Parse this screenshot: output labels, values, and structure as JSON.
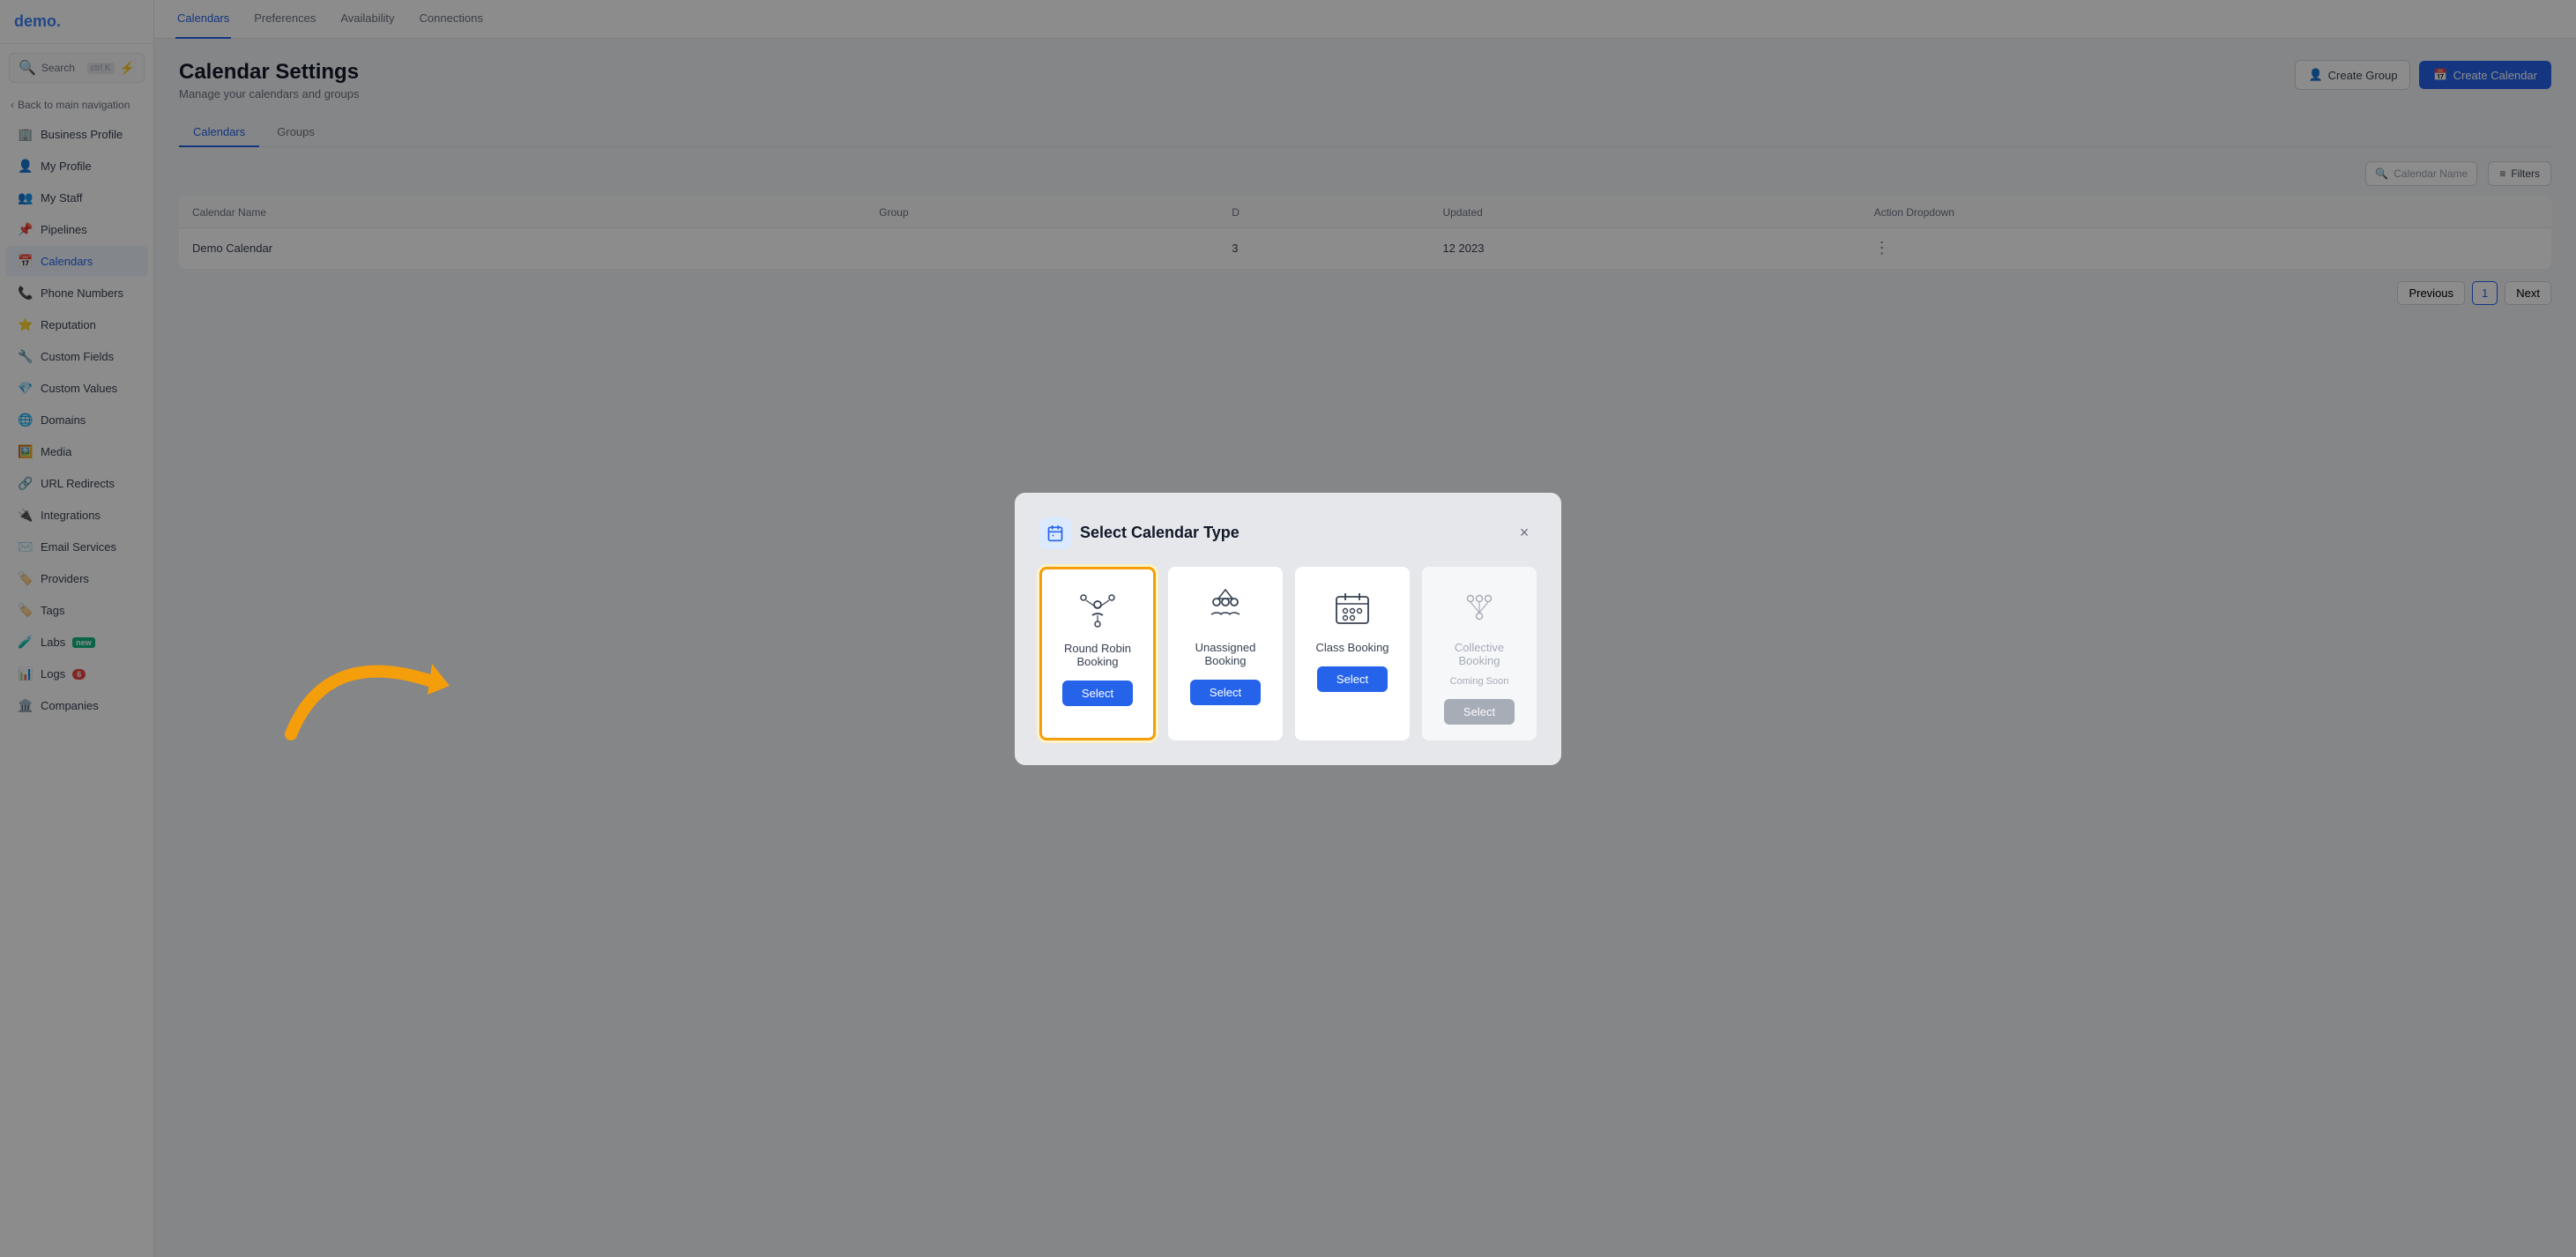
{
  "app": {
    "logo": "demo.",
    "logo_dot_color": "#3b82f6"
  },
  "sidebar": {
    "search_label": "Search",
    "search_kbd": "ctrl K",
    "back_nav": "Back to main navigation",
    "items": [
      {
        "id": "business-profile",
        "label": "Business Profile",
        "icon": "🏢"
      },
      {
        "id": "my-profile",
        "label": "My Profile",
        "icon": "👤"
      },
      {
        "id": "my-staff",
        "label": "My Staff",
        "icon": "👥"
      },
      {
        "id": "pipelines",
        "label": "Pipelines",
        "icon": "📌"
      },
      {
        "id": "calendars",
        "label": "Calendars",
        "icon": "📅",
        "active": true
      },
      {
        "id": "phone-numbers",
        "label": "Phone Numbers",
        "icon": "📞"
      },
      {
        "id": "reputation",
        "label": "Reputation",
        "icon": "⭐"
      },
      {
        "id": "custom-fields",
        "label": "Custom Fields",
        "icon": "🔧"
      },
      {
        "id": "custom-values",
        "label": "Custom Values",
        "icon": "💎"
      },
      {
        "id": "domains",
        "label": "Domains",
        "icon": "🌐"
      },
      {
        "id": "media",
        "label": "Media",
        "icon": "🖼️"
      },
      {
        "id": "url-redirects",
        "label": "URL Redirects",
        "icon": "🔗"
      },
      {
        "id": "integrations",
        "label": "Integrations",
        "icon": "🔌"
      },
      {
        "id": "email-services",
        "label": "Email Services",
        "icon": "✉️"
      },
      {
        "id": "providers",
        "label": "Providers",
        "icon": "🏷️"
      },
      {
        "id": "tags",
        "label": "Tags",
        "icon": "🏷️"
      },
      {
        "id": "labs",
        "label": "Labs",
        "icon": "🧪",
        "badge": "new"
      },
      {
        "id": "logs",
        "label": "Logs",
        "icon": "📊",
        "badge_num": "6"
      },
      {
        "id": "companies",
        "label": "Companies",
        "icon": "🏛️"
      }
    ]
  },
  "top_nav": {
    "tabs": [
      {
        "id": "calendars",
        "label": "Calendars",
        "active": true
      },
      {
        "id": "preferences",
        "label": "Preferences"
      },
      {
        "id": "availability",
        "label": "Availability"
      },
      {
        "id": "connections",
        "label": "Connections"
      }
    ]
  },
  "page": {
    "title": "Calendar Settings",
    "subtitle": "Manage your calendars and groups",
    "create_group_label": "Create Group",
    "create_calendar_label": "Create Calendar"
  },
  "sub_tabs": [
    {
      "id": "calendars",
      "label": "Calendars",
      "active": true
    },
    {
      "id": "groups",
      "label": "Groups"
    }
  ],
  "table": {
    "search_placeholder": "Calendar Name",
    "filters_label": "Filters",
    "columns": [
      "Calendar Name",
      "Group",
      "D",
      "Updated",
      "Action Dropdown"
    ],
    "rows": [
      {
        "name": "Demo Calendar",
        "group": "",
        "d": "3",
        "updated": "12 2023",
        "updated_sub": ""
      }
    ],
    "pagination": {
      "prev": "Previous",
      "next": "Next",
      "current_page": "1"
    }
  },
  "modal": {
    "title": "Select Calendar Type",
    "close_label": "×",
    "cards": [
      {
        "id": "round-robin",
        "title": "Round Robin Booking",
        "select_label": "Select",
        "selected": true,
        "disabled": false,
        "coming_soon": false
      },
      {
        "id": "unassigned",
        "title": "Unassigned Booking",
        "select_label": "Select",
        "selected": false,
        "disabled": false,
        "coming_soon": false
      },
      {
        "id": "class",
        "title": "Class Booking",
        "select_label": "Select",
        "selected": false,
        "disabled": false,
        "coming_soon": false
      },
      {
        "id": "collective",
        "title": "Collective Booking",
        "select_label": "Select",
        "selected": false,
        "disabled": true,
        "coming_soon": true,
        "coming_soon_label": "Coming Soon"
      }
    ]
  }
}
